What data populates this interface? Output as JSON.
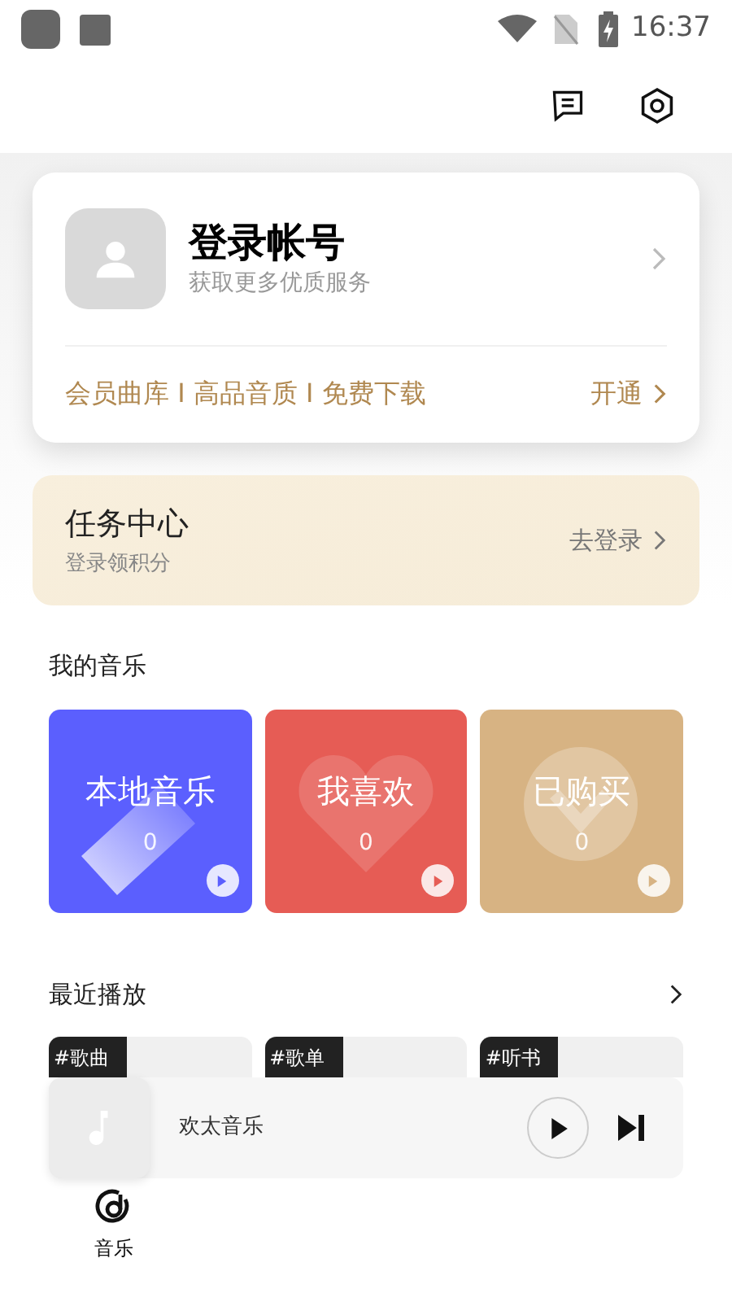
{
  "status_bar": {
    "time": "16:37"
  },
  "account": {
    "title": "登录帐号",
    "subtitle": "获取更多优质服务",
    "vip_benefits": "会员曲库 I 高品音质 I 免费下载",
    "vip_action": "开通"
  },
  "task_center": {
    "title": "任务中心",
    "subtitle": "登录领积分",
    "action": "去登录"
  },
  "my_music": {
    "title": "我的音乐",
    "tiles": [
      {
        "kind": "local",
        "label": "本地音乐",
        "count": "0",
        "color": "#5b5ffe"
      },
      {
        "kind": "favorite",
        "label": "我喜欢",
        "count": "0",
        "color": "#e65c55"
      },
      {
        "kind": "purchased",
        "label": "已购买",
        "count": "0",
        "color": "#d7b383"
      }
    ]
  },
  "recent": {
    "title": "最近播放",
    "cards": [
      {
        "tag": "#歌曲"
      },
      {
        "tag": "#歌单"
      },
      {
        "tag": "#听书"
      }
    ]
  },
  "mini_player": {
    "title": "欢太音乐"
  },
  "bottom_nav": [
    {
      "label": "音乐",
      "selected": true
    }
  ]
}
